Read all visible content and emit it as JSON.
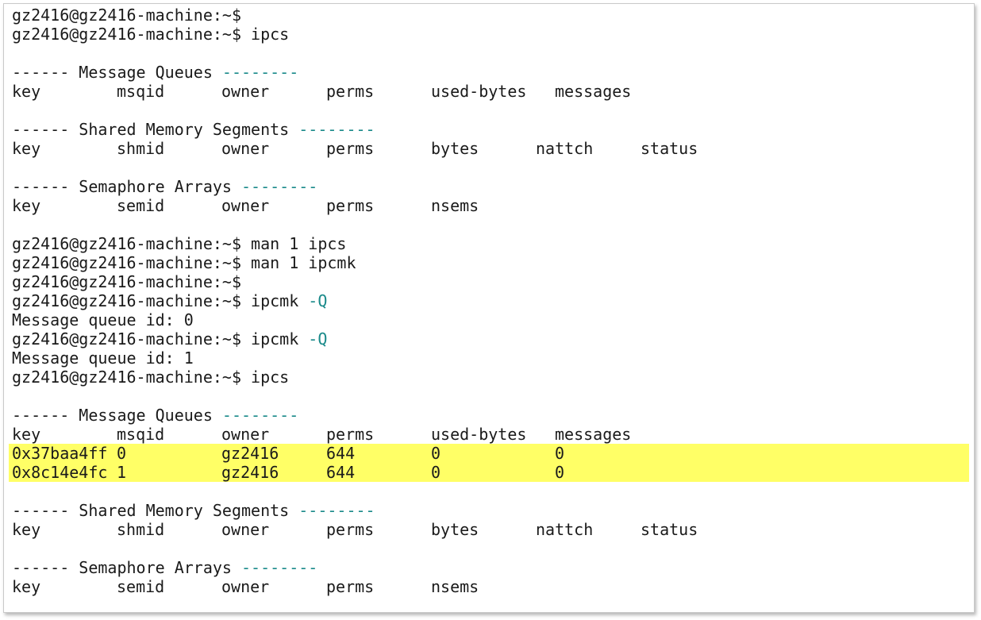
{
  "prompt": "gz2416@gz2416-machine:~$",
  "dashes": "--------",
  "lead_dashes": "------",
  "headers": {
    "msg": "Message Queues",
    "shm": "Shared Memory Segments",
    "sem": "Semaphore Arrays"
  },
  "columns": {
    "key": "key",
    "msqid": "msqid",
    "shmid": "shmid",
    "semid": "semid",
    "owner": "owner",
    "perms": "perms",
    "used_bytes": "used-bytes",
    "messages": "messages",
    "bytes": "bytes",
    "nattch": "nattch",
    "status": "status",
    "nsems": "nsems"
  },
  "commands": {
    "c1": "",
    "c2": "ipcs",
    "c3": "man 1 ipcs",
    "c4": "man 1 ipcmk",
    "c5": "",
    "c6_cmd": "ipcmk",
    "c6_opt": "-Q",
    "c7_cmd": "ipcmk",
    "c7_opt": "-Q",
    "c8": "ipcs"
  },
  "outputs": {
    "o1": "Message queue id: 0",
    "o2": "Message queue id: 1"
  },
  "queue_rows": [
    {
      "key": "0x37baa4ff",
      "msqid": "0",
      "owner": "gz2416",
      "perms": "644",
      "used_bytes": "0",
      "messages": "0"
    },
    {
      "key": "0x8c14e4fc",
      "msqid": "1",
      "owner": "gz2416",
      "perms": "644",
      "used_bytes": "0",
      "messages": "0"
    }
  ],
  "highlight_color": "#ffff66",
  "dash_color": "#1a8a8a"
}
